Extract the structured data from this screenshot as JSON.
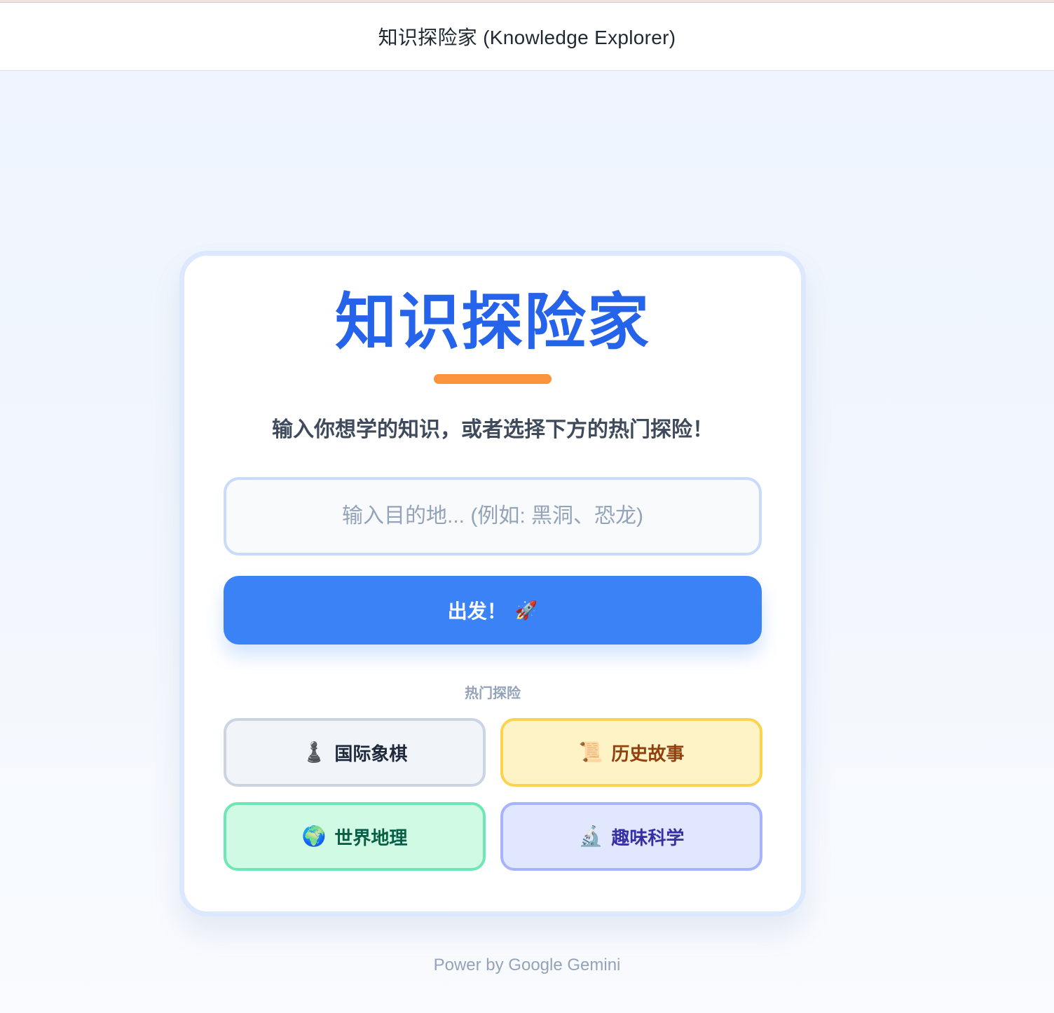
{
  "window": {
    "title": "知识探险家 (Knowledge Explorer)"
  },
  "card": {
    "title": "知识探险家",
    "subtitle": "输入你想学的知识，或者选择下方的热门探险！",
    "search": {
      "placeholder": "输入目的地... (例如: 黑洞、恐龙)",
      "value": ""
    },
    "go_button": {
      "label": "出发！",
      "icon": "🚀"
    },
    "popular_label": "热门探险",
    "topics": [
      {
        "label": "国际象棋",
        "icon": "♟️",
        "icon_name": "chess-pawn-icon"
      },
      {
        "label": "历史故事",
        "icon": "📜",
        "icon_name": "scroll-icon"
      },
      {
        "label": "世界地理",
        "icon": "🌍",
        "icon_name": "globe-icon"
      },
      {
        "label": "趣味科学",
        "icon": "🔬",
        "icon_name": "microscope-icon"
      }
    ]
  },
  "footer": {
    "text": "Power by Google Gemini"
  },
  "colors": {
    "accent": "#2563eb",
    "button": "#3b82f6",
    "underline": "#fb923c"
  }
}
